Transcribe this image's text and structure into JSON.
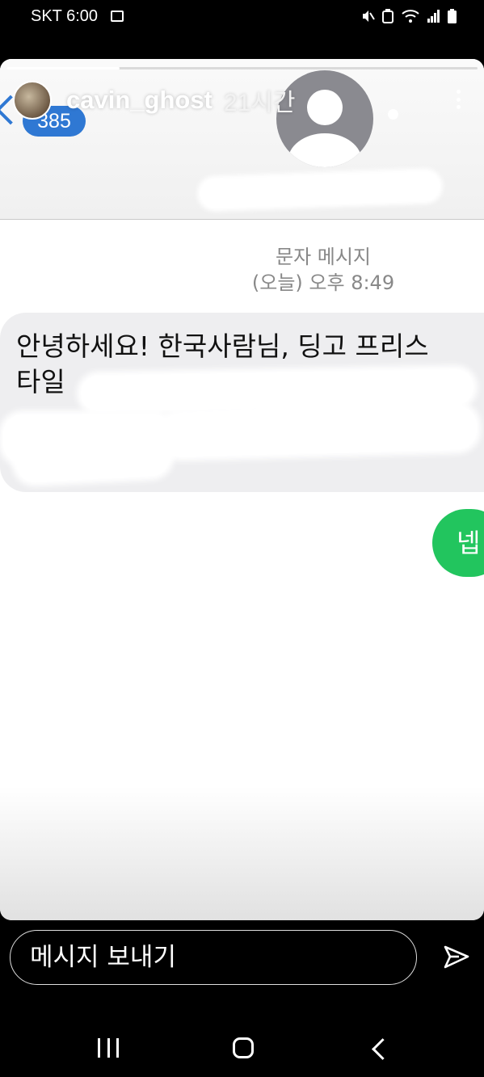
{
  "status_bar": {
    "carrier": "SKT",
    "time": "6:00",
    "icons": [
      "gallery-icon",
      "mute-vibrate-icon",
      "battery-saver-icon",
      "wifi-icon",
      "signal-icon",
      "battery-icon"
    ]
  },
  "story": {
    "username": "cavin_ghost",
    "time_ago": "21시간",
    "progress": 0.24,
    "menu_icon": "more-vertical-icon"
  },
  "sms_screenshot": {
    "unread_count": "385",
    "message_type": "문자 메시지",
    "timestamp": "(오늘) 오후 8:49",
    "incoming_text_line1": "안녕하세요! 한국사람님, 딩고 프리스",
    "incoming_text_line2": "타일",
    "outgoing_text": "넵",
    "colors": {
      "incoming_bubble": "#eeeef0",
      "outgoing_bubble": "#22c55e",
      "accent": "#2f78d3"
    }
  },
  "reply": {
    "placeholder": "메시지 보내기",
    "send_icon": "send-icon"
  },
  "nav_bar": {
    "icons": [
      "recents-icon",
      "home-icon",
      "back-icon"
    ]
  }
}
